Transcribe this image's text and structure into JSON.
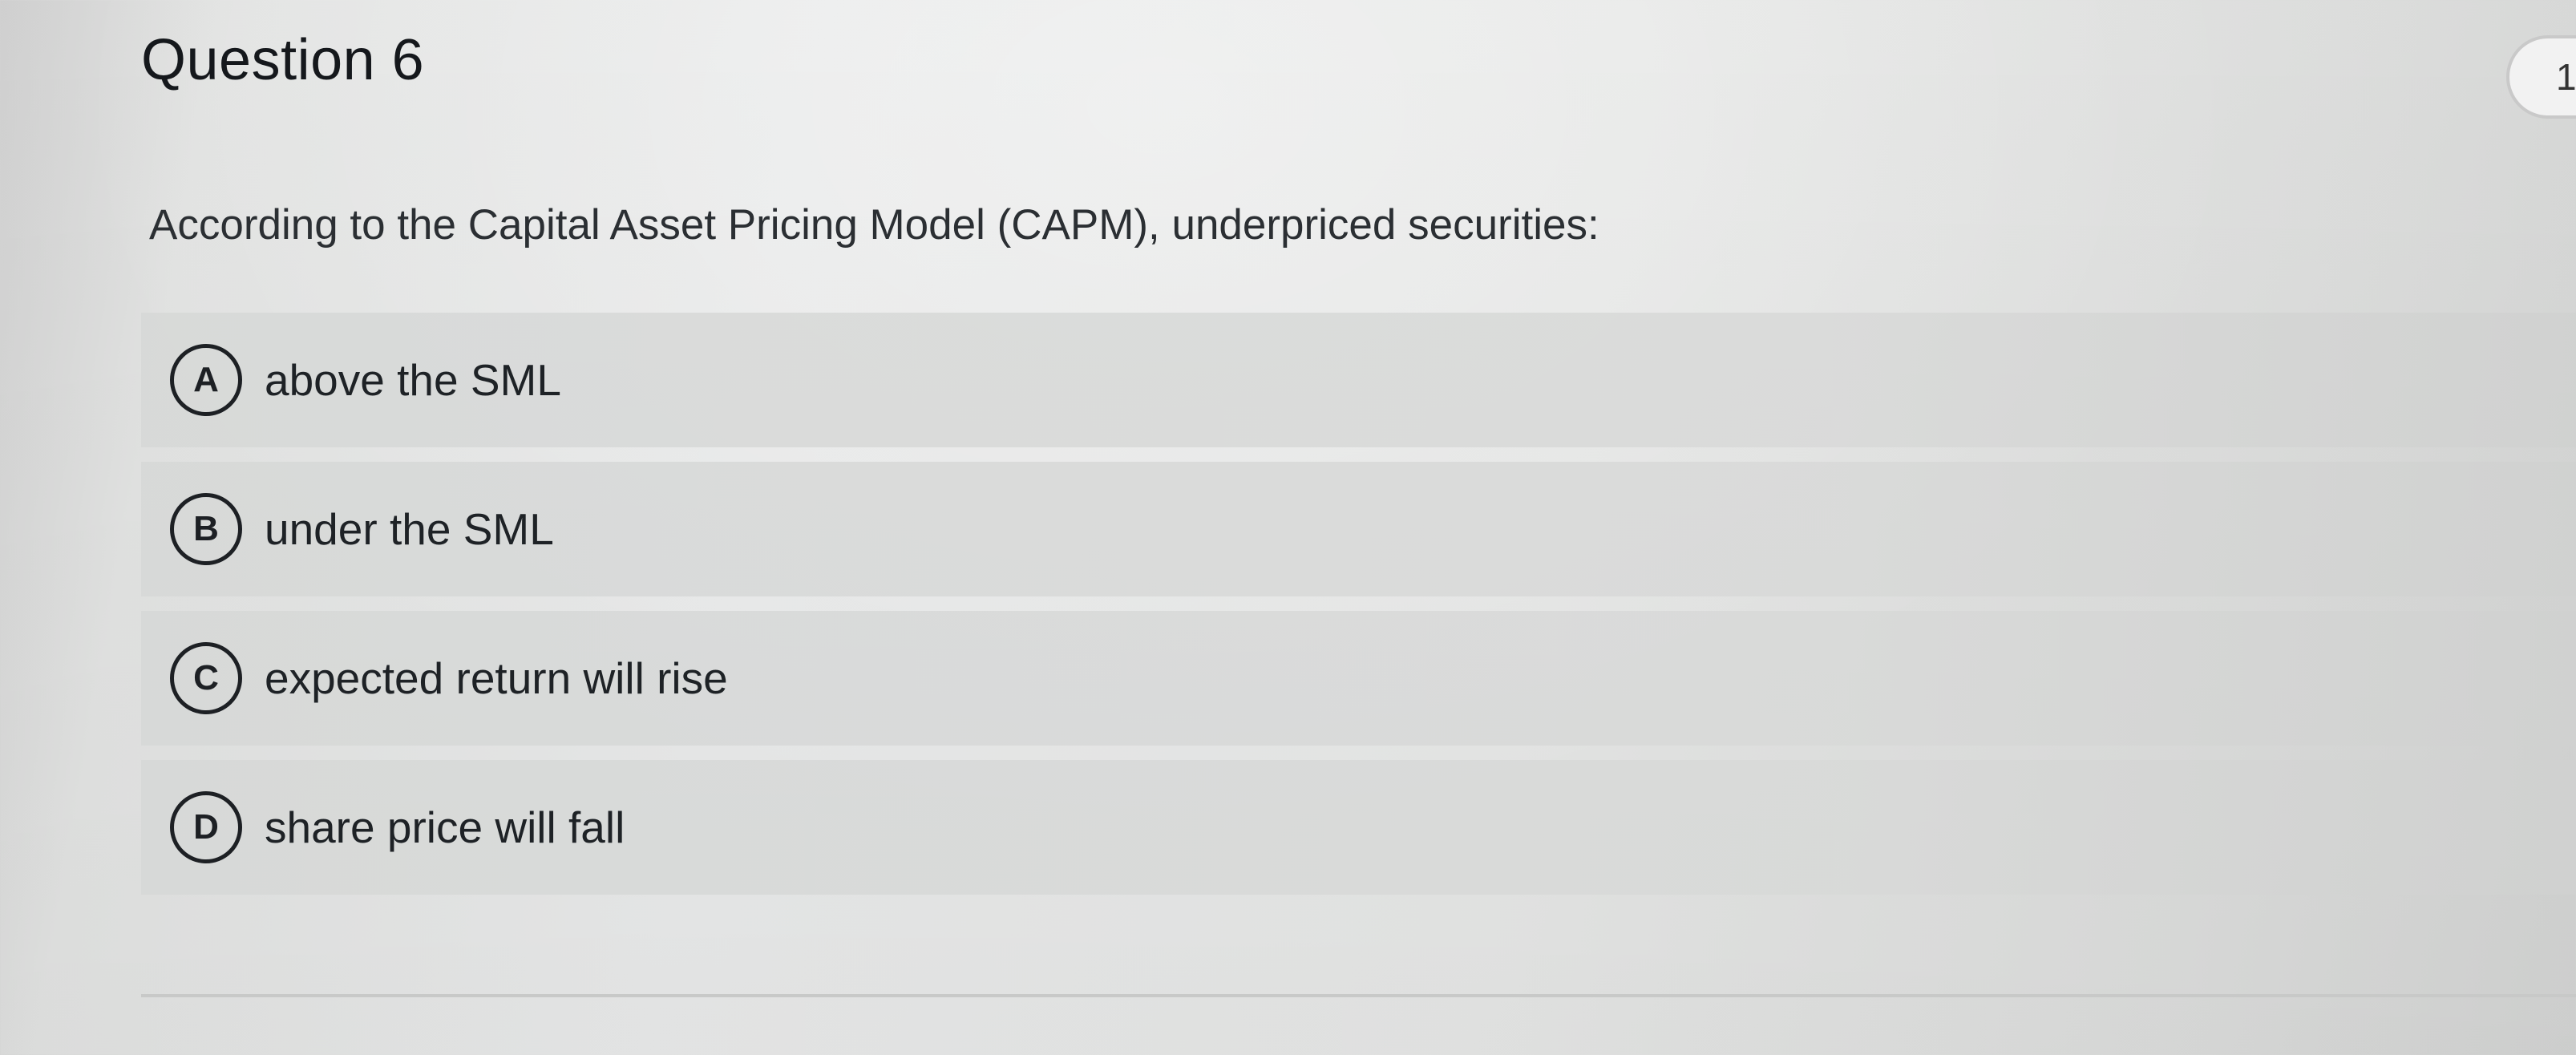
{
  "question": {
    "title": "Question 6",
    "points_badge": "1",
    "prompt": "According to the Capital Asset Pricing Model (CAPM), underpriced securities:"
  },
  "options": [
    {
      "letter": "A",
      "text": "above the SML"
    },
    {
      "letter": "B",
      "text": "under the SML"
    },
    {
      "letter": "C",
      "text": "expected return will rise"
    },
    {
      "letter": "D",
      "text": "share price will fall"
    }
  ]
}
